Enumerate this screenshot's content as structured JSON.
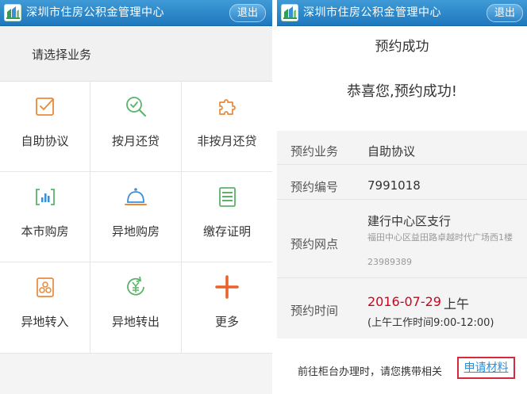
{
  "header": {
    "title": "深圳市住房公积金管理中心",
    "logout_label": "退出",
    "logo_icon": "housing-fund-logo-icon"
  },
  "services": {
    "prompt": "请选择业务",
    "items": [
      {
        "label": "自助协议",
        "icon": "checkbox-edit-icon"
      },
      {
        "label": "按月还贷",
        "icon": "magnifier-check-icon"
      },
      {
        "label": "非按月还贷",
        "icon": "puzzle-icon"
      },
      {
        "label": "本市购房",
        "icon": "bar-chart-icon"
      },
      {
        "label": "异地购房",
        "icon": "service-bell-icon"
      },
      {
        "label": "缴存证明",
        "icon": "document-icon"
      },
      {
        "label": "异地转入",
        "icon": "coin-stack-icon"
      },
      {
        "label": "异地转出",
        "icon": "yen-refresh-icon"
      },
      {
        "label": "更多",
        "icon": "plus-icon"
      }
    ]
  },
  "result": {
    "title": "预约成功",
    "congrats": "恭喜您,预约成功!",
    "rows": {
      "service": {
        "key": "预约业务",
        "value": "自助协议"
      },
      "number": {
        "key": "预约编号",
        "value": "7991018"
      },
      "branch": {
        "key": "预约网点",
        "name": "建行中心区支行",
        "address": "福田中心区益田路卓越时代广场西1楼",
        "phone": "23989389"
      },
      "time": {
        "key": "预约时间",
        "date": "2016-07-29",
        "period": "上午",
        "hours": "(上午工作时间9:00-12:00)"
      }
    },
    "notice": "前往柜台办理时，请您携带相关",
    "apply_link": "申请材料"
  },
  "colors": {
    "header_blue": "#2a86c9",
    "icon_orange": "#e8893a",
    "icon_green": "#5bb36a",
    "icon_blue": "#3a8fd6",
    "date_red": "#d0021b",
    "link_blue": "#2a8fd8",
    "highlight_red": "#d42a3e"
  }
}
